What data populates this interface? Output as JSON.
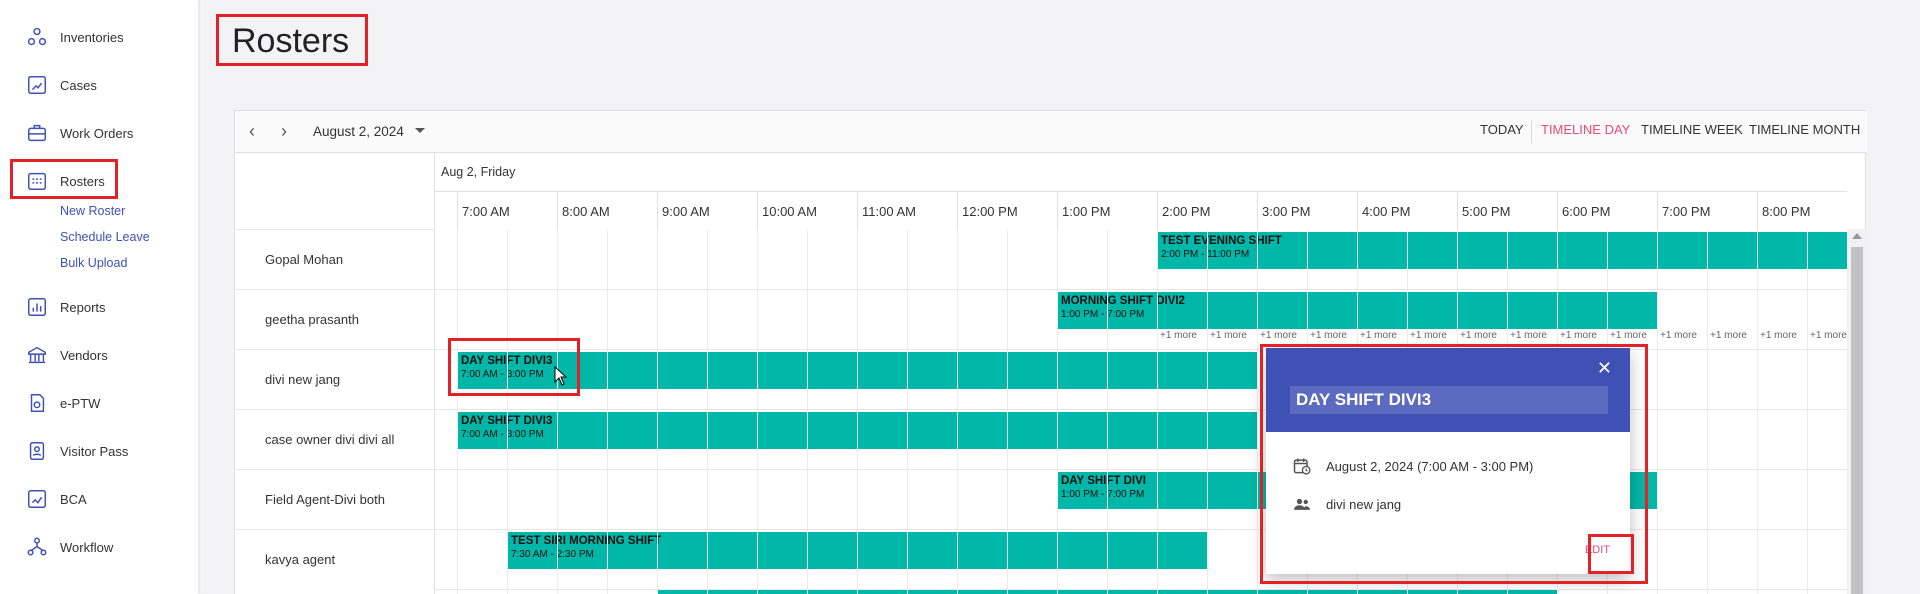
{
  "sidebar": {
    "items": [
      {
        "label": "Inventories",
        "icon": "inventories-icon"
      },
      {
        "label": "Cases",
        "icon": "cases-icon"
      },
      {
        "label": "Work Orders",
        "icon": "work-orders-icon"
      },
      {
        "label": "Rosters",
        "icon": "rosters-icon"
      },
      {
        "label": "Reports",
        "icon": "reports-icon"
      },
      {
        "label": "Vendors",
        "icon": "vendors-icon"
      },
      {
        "label": "e-PTW",
        "icon": "eptw-icon"
      },
      {
        "label": "Visitor Pass",
        "icon": "visitor-pass-icon"
      },
      {
        "label": "BCA",
        "icon": "bca-icon"
      },
      {
        "label": "Workflow",
        "icon": "workflow-icon"
      }
    ],
    "sub_items": [
      "New Roster",
      "Schedule Leave",
      "Bulk Upload"
    ]
  },
  "page": {
    "title": "Rosters"
  },
  "toolbar": {
    "date": "August 2, 2024",
    "views": [
      "TODAY",
      "TIMELINE DAY",
      "TIMELINE WEEK",
      "TIMELINE MONTH"
    ],
    "active_view": "TIMELINE DAY"
  },
  "timeline": {
    "day_label": "Aug 2, Friday",
    "hours": [
      "7:00 AM",
      "8:00 AM",
      "9:00 AM",
      "10:00 AM",
      "11:00 AM",
      "12:00 PM",
      "1:00 PM",
      "2:00 PM",
      "3:00 PM",
      "4:00 PM",
      "5:00 PM",
      "6:00 PM",
      "7:00 PM",
      "8:00 PM"
    ],
    "resources": [
      "Gopal Mohan",
      "geetha prasanth",
      "divi new jang",
      "case owner divi divi all",
      "Field Agent-Divi both",
      "kavya agent"
    ],
    "more_label": "+1 more",
    "events": [
      {
        "title": "TEST EVENING SHIFT",
        "time": "2:00 PM - 11:00 PM"
      },
      {
        "title": "MORNING SHIFT DIVI2",
        "time": "1:00 PM - 7:00 PM"
      },
      {
        "title": "DAY SHIFT DIVI3",
        "time": "7:00 AM - 3:00 PM"
      },
      {
        "title": "DAY SHIFT DIVI3",
        "time": "7:00 AM - 3:00 PM"
      },
      {
        "title": "DAY SHIFT DIVI",
        "time": "1:00 PM - 7:00 PM"
      },
      {
        "title": "TEST SIRI MORNING SHIFT",
        "time": "7:30 AM - 2:30 PM"
      }
    ]
  },
  "popup": {
    "title": "DAY SHIFT DIVI3",
    "datetime": "August 2, 2024 (7:00 AM - 3:00 PM)",
    "resource": "divi new jang",
    "edit_label": "EDIT"
  },
  "colors": {
    "accent": "#3f51b5",
    "event": "#00b7a8",
    "active_view": "#e94a7c",
    "highlight": "#e32227"
  }
}
